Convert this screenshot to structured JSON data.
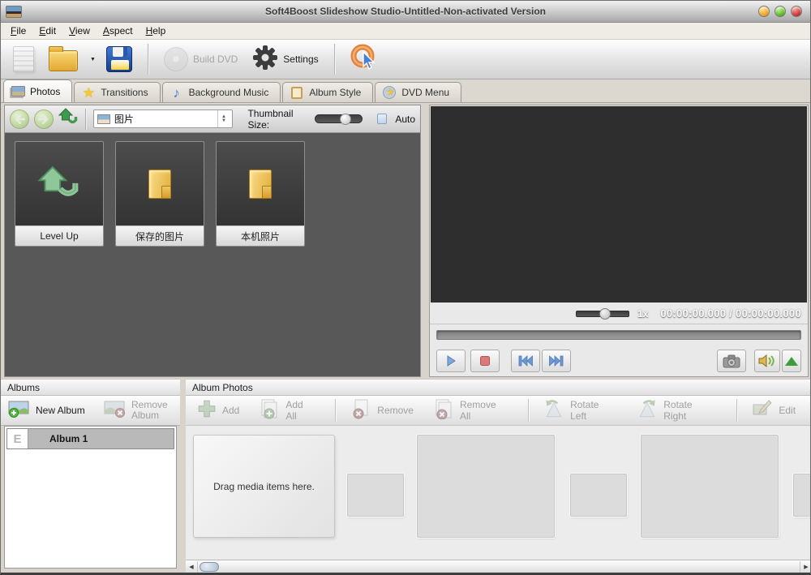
{
  "window": {
    "title": "Soft4Boost Slideshow Studio-Untitled-Non-activated Version"
  },
  "menu": {
    "items": [
      {
        "accel": "F",
        "rest": "ile"
      },
      {
        "accel": "E",
        "rest": "dit"
      },
      {
        "accel": "V",
        "rest": "iew"
      },
      {
        "accel": "A",
        "rest": "spect"
      },
      {
        "accel": "H",
        "rest": "elp"
      }
    ]
  },
  "toolbar": {
    "build_dvd_label": "Build DVD",
    "settings_label": "Settings"
  },
  "tabs": [
    {
      "label": "Photos"
    },
    {
      "label": "Transitions"
    },
    {
      "label": "Background Music"
    },
    {
      "label": "Album Style"
    },
    {
      "label": "DVD Menu"
    }
  ],
  "browser": {
    "location_value": "图片",
    "thumbnail_size_label": "Thumbnail Size:",
    "auto_label": "Auto",
    "files": [
      {
        "label": "Level Up",
        "icon": "level-up-arrow"
      },
      {
        "label": "保存的图片",
        "icon": "folder"
      },
      {
        "label": "本机照片",
        "icon": "folder"
      }
    ]
  },
  "preview": {
    "speed_label": "1x",
    "time_current": "00:00:00.000",
    "time_separator": "/",
    "time_total": "00:00:00.000"
  },
  "albums": {
    "header": "Albums",
    "new_album_label": "New Album",
    "remove_album_label": "Remove Album",
    "items": [
      {
        "icon_letter": "E",
        "label": "Album 1"
      }
    ]
  },
  "album_photos": {
    "header": "Album Photos",
    "add_label": "Add",
    "add_all_label": "Add All",
    "remove_label": "Remove",
    "remove_all_label": "Remove All",
    "rotate_left_label": "Rotate Left",
    "rotate_right_label": "Rotate Right",
    "edit_label": "Edit",
    "drop_hint": "Drag media items here."
  },
  "glyphs": {
    "spinner_up": "▲",
    "spinner_down": "▼",
    "dropdown_arrow": "▼",
    "scroll_left": "◀",
    "scroll_right": "▶",
    "star": "★",
    "music_note": "♪"
  },
  "colors": {
    "accent_green": "#7cc576",
    "accent_red": "#d9534f",
    "accent_blue": "#6b97d4",
    "folder_yellow": "#f0c457",
    "video_bg": "#2e2e2e"
  }
}
